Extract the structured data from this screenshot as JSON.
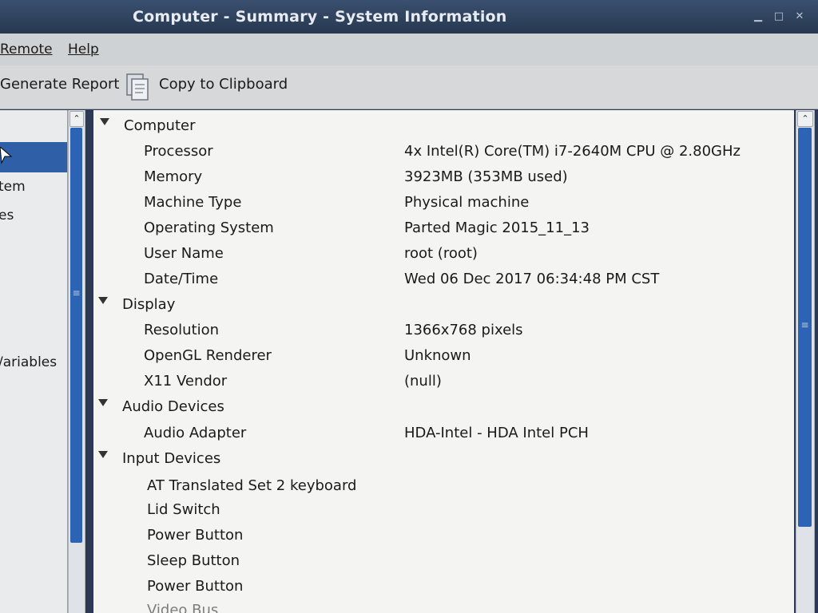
{
  "window": {
    "title": "Computer - Summary - System Information"
  },
  "menubar": {
    "items": [
      {
        "label": "Remote"
      },
      {
        "label": "Help"
      }
    ]
  },
  "toolbar": {
    "generate_report": "Generate Report",
    "copy_to_clipboard": "Copy to Clipboard"
  },
  "sidebar": {
    "items": [
      {
        "label": "tem"
      },
      {
        "label": "es"
      },
      {
        "label": "/ariables"
      }
    ]
  },
  "tree": {
    "computer": {
      "label": "Computer",
      "rows": [
        {
          "key": "Processor",
          "value": "4x Intel(R) Core(TM) i7-2640M CPU @ 2.80GHz"
        },
        {
          "key": "Memory",
          "value": "3923MB (353MB used)"
        },
        {
          "key": "Machine Type",
          "value": "Physical machine"
        },
        {
          "key": "Operating System",
          "value": "Parted Magic 2015_11_13"
        },
        {
          "key": "User Name",
          "value": "root (root)"
        },
        {
          "key": "Date/Time",
          "value": "Wed 06 Dec 2017 06:34:48 PM CST"
        }
      ]
    },
    "display": {
      "label": "Display",
      "rows": [
        {
          "key": "Resolution",
          "value": "1366x768 pixels"
        },
        {
          "key": "OpenGL Renderer",
          "value": "Unknown"
        },
        {
          "key": "X11 Vendor",
          "value": "(null)"
        }
      ]
    },
    "audio": {
      "label": "Audio Devices",
      "rows": [
        {
          "key": "Audio Adapter",
          "value": "HDA-Intel - HDA Intel PCH"
        }
      ]
    },
    "input": {
      "label": "Input Devices",
      "rows": [
        {
          "key": "AT Translated Set 2 keyboard"
        },
        {
          "key": "Lid Switch"
        },
        {
          "key": "Power Button"
        },
        {
          "key": "Sleep Button"
        },
        {
          "key": "Power Button"
        },
        {
          "key": "Video Bus"
        }
      ]
    }
  },
  "colors": {
    "titlebar": "#27384f",
    "selection": "#2f5fa6",
    "scroll_thumb": "#2c63b4",
    "pane_bg": "#f4f4f2"
  },
  "icons": [
    "close-icon",
    "maximize-icon",
    "minimize-icon",
    "clipboard-icon",
    "expander-triangle-icon",
    "scroll-up-arrow-icon"
  ]
}
